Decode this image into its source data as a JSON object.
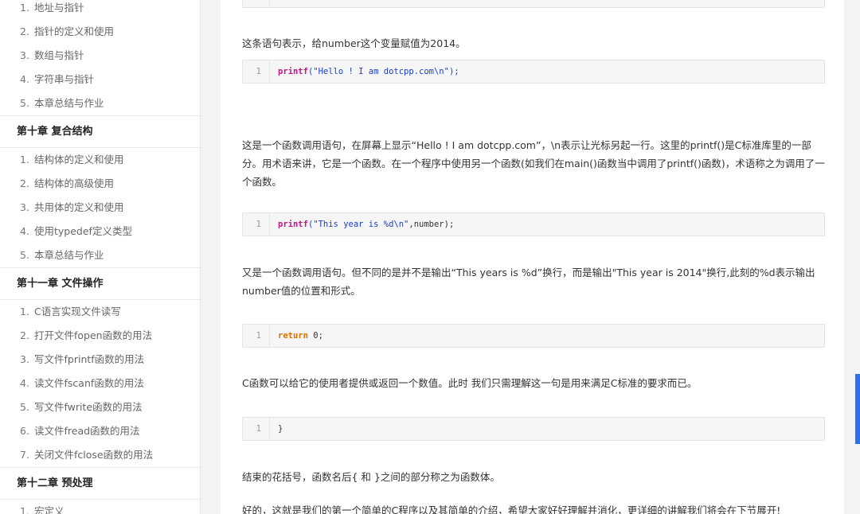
{
  "sidebar": {
    "sections": [
      {
        "items": [
          {
            "num": "1.",
            "label": "地址与指针"
          },
          {
            "num": "2.",
            "label": "指针的定义和使用"
          },
          {
            "num": "3.",
            "label": "数组与指针"
          },
          {
            "num": "4.",
            "label": "字符串与指针"
          },
          {
            "num": "5.",
            "label": "本章总结与作业"
          }
        ]
      },
      {
        "chapter": "第十章 复合结构",
        "items": [
          {
            "num": "1.",
            "label": "结构体的定义和使用"
          },
          {
            "num": "2.",
            "label": "结构体的高级使用"
          },
          {
            "num": "3.",
            "label": "共用体的定义和使用"
          },
          {
            "num": "4.",
            "label": "使用typedef定义类型"
          },
          {
            "num": "5.",
            "label": "本章总结与作业"
          }
        ]
      },
      {
        "chapter": "第十一章 文件操作",
        "items": [
          {
            "num": "1.",
            "label": "C语言实现文件读写"
          },
          {
            "num": "2.",
            "label": "打开文件fopen函数的用法"
          },
          {
            "num": "3.",
            "label": "写文件fprintf函数的用法"
          },
          {
            "num": "4.",
            "label": "读文件fscanf函数的用法"
          },
          {
            "num": "5.",
            "label": "写文件fwrite函数的用法"
          },
          {
            "num": "6.",
            "label": "读文件fread函数的用法"
          },
          {
            "num": "7.",
            "label": "关闭文件fclose函数的用法"
          }
        ]
      },
      {
        "chapter": "第十二章 预处理",
        "items": [
          {
            "num": "1.",
            "label": "宏定义"
          }
        ]
      }
    ]
  },
  "content": {
    "p1": "这条语句表示，给number这个变量赋值为2014。",
    "code1": {
      "line": "1",
      "fn": "printf",
      "str": "(\"Hello ! I am dotcpp.com\\n\");"
    },
    "p2": "这是一个函数调用语句，在屏幕上显示“Hello ! I am dotcpp.com”，\\n表示让光标另起一行。这里的printf()是C标准库里的一部分。用术语来讲，它是一个函数。在一个程序中使用另一个函数(如我们在main()函数当中调用了printf()函数)，术语称之为调用了一个函数。",
    "code2": {
      "line": "1",
      "fn": "printf",
      "str": "(\"This year is %d\\n\"",
      "rest": ",number);"
    },
    "p3": "又是一个函数调用语句。但不同的是并不是输出“This years is %d”换行，而是输出\"This year is 2014\"换行,此刻的%d表示输出number值的位置和形式。",
    "code3": {
      "line": "1",
      "kw": "return",
      "rest": " 0;"
    },
    "p4": "C函数可以给它的使用者提供或返回一个数值。此时 我们只需理解这一句是用来满足C标准的要求而已。",
    "code4": {
      "line": "1",
      "rest": "}"
    },
    "p5": "结束的花括号，函数名后{ 和 }之间的部分称之为函数体。",
    "p6": "好的，这就是我们的第一个简单的C程序以及其简单的介绍，希望大家好好理解并消化，更详细的讲解我们将会在下节展开!"
  }
}
